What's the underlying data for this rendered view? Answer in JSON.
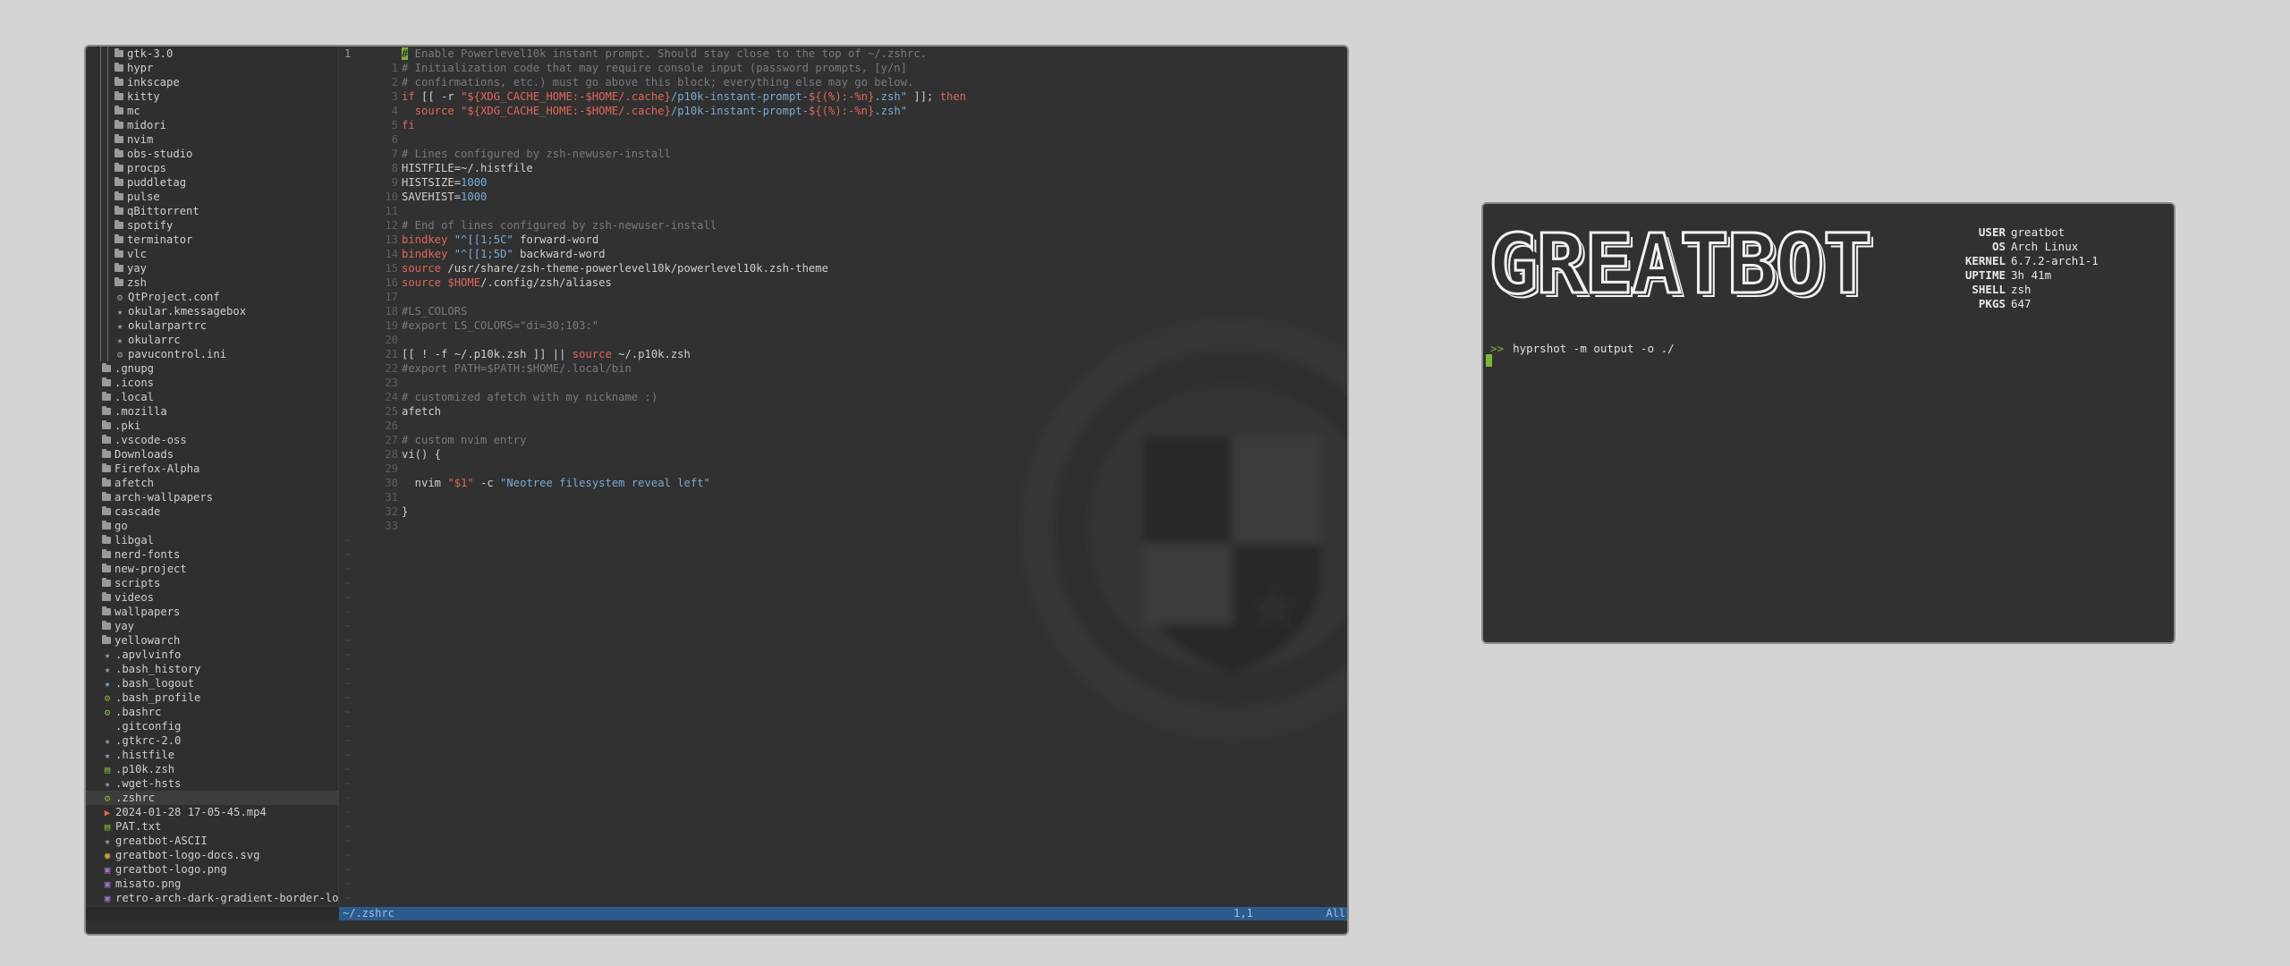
{
  "tree": {
    "nested": [
      {
        "label": "gtk-3.0",
        "type": "folder"
      },
      {
        "label": "hypr",
        "type": "folder"
      },
      {
        "label": "inkscape",
        "type": "folder"
      },
      {
        "label": "kitty",
        "type": "folder"
      },
      {
        "label": "mc",
        "type": "folder"
      },
      {
        "label": "midori",
        "type": "folder"
      },
      {
        "label": "nvim",
        "type": "folder"
      },
      {
        "label": "obs-studio",
        "type": "folder"
      },
      {
        "label": "procps",
        "type": "folder"
      },
      {
        "label": "puddletag",
        "type": "folder"
      },
      {
        "label": "pulse",
        "type": "folder"
      },
      {
        "label": "qBittorrent",
        "type": "folder"
      },
      {
        "label": "spotify",
        "type": "folder"
      },
      {
        "label": "terminator",
        "type": "folder"
      },
      {
        "label": "vlc",
        "type": "folder"
      },
      {
        "label": "yay",
        "type": "folder"
      },
      {
        "label": "zsh",
        "type": "folder"
      },
      {
        "label": "QtProject.conf",
        "type": "gear"
      },
      {
        "label": "okular.kmessagebox",
        "type": "star"
      },
      {
        "label": "okularpartrc",
        "type": "star"
      },
      {
        "label": "okularrc",
        "type": "star"
      },
      {
        "label": "pavucontrol.ini",
        "type": "gear"
      }
    ],
    "top": [
      {
        "label": ".gnupg",
        "type": "folder"
      },
      {
        "label": ".icons",
        "type": "folder"
      },
      {
        "label": ".local",
        "type": "folder"
      },
      {
        "label": ".mozilla",
        "type": "folder"
      },
      {
        "label": ".pki",
        "type": "folder"
      },
      {
        "label": ".vscode-oss",
        "type": "folder"
      },
      {
        "label": "Downloads",
        "type": "folder"
      },
      {
        "label": "Firefox-Alpha",
        "type": "folder"
      },
      {
        "label": "afetch",
        "type": "folder"
      },
      {
        "label": "arch-wallpapers",
        "type": "folder"
      },
      {
        "label": "cascade",
        "type": "folder"
      },
      {
        "label": "go",
        "type": "folder"
      },
      {
        "label": "libgal",
        "type": "folder"
      },
      {
        "label": "nerd-fonts",
        "type": "folder"
      },
      {
        "label": "new-project",
        "type": "folder"
      },
      {
        "label": "scripts",
        "type": "folder"
      },
      {
        "label": "videos",
        "type": "folder"
      },
      {
        "label": "wallpapers",
        "type": "folder"
      },
      {
        "label": "yay",
        "type": "folder"
      },
      {
        "label": "yellowarch",
        "type": "folder"
      },
      {
        "label": ".apvlvinfo",
        "type": "star"
      },
      {
        "label": ".bash_history",
        "type": "star"
      },
      {
        "label": ".bash_logout",
        "type": "star-blue"
      },
      {
        "label": ".bash_profile",
        "type": "gear-green"
      },
      {
        "label": ".bashrc",
        "type": "gear-green"
      },
      {
        "label": ".gitconfig",
        "type": "none"
      },
      {
        "label": ".gtkrc-2.0",
        "type": "star"
      },
      {
        "label": ".histfile",
        "type": "star"
      },
      {
        "label": ".p10k.zsh",
        "type": "file-green"
      },
      {
        "label": ".wget-hsts",
        "type": "star"
      },
      {
        "label": ".zshrc",
        "type": "gear-green",
        "selected": true
      },
      {
        "label": "2024-01-28 17-05-45.mp4",
        "type": "video"
      },
      {
        "label": "PAT.txt",
        "type": "file-green"
      },
      {
        "label": "greatbot-ASCII",
        "type": "star"
      },
      {
        "label": "greatbot-logo-docs.svg",
        "type": "svg"
      },
      {
        "label": "greatbot-logo.png",
        "type": "image"
      },
      {
        "label": "misato.png",
        "type": "image"
      },
      {
        "label": "retro-arch-dark-gradient-border-lo",
        "type": "image"
      }
    ]
  },
  "editor": {
    "current_line": "1",
    "relative_numbers": [
      "1",
      "2",
      "3",
      "4",
      "5",
      "6",
      "7",
      "8",
      "9",
      "10",
      "11",
      "12",
      "13",
      "14",
      "15",
      "16",
      "17",
      "18",
      "19",
      "20",
      "21",
      "22",
      "23",
      "24",
      "25",
      "26",
      "27",
      "28",
      "29",
      "30",
      "31",
      "32",
      "33"
    ],
    "lines": [
      [
        [
          "cursor-cell",
          "#"
        ],
        [
          "cmt",
          " Enable Powerlevel10k instant prompt. Should stay close to the top of ~/.zshrc."
        ]
      ],
      [
        [
          "cmt",
          "# Initialization code that may require console input (password prompts, [y/n]"
        ]
      ],
      [
        [
          "cmt",
          "# confirmations, etc.) must go above this block; everything else may go below."
        ]
      ],
      [
        [
          "kw",
          "if"
        ],
        [
          "",
          " [[ -r "
        ],
        [
          "str",
          "\"${XDG_CACHE_HOME:-$HOME/.cache}"
        ],
        [
          "blu",
          "/p10k-instant-prompt-"
        ],
        [
          "str",
          "${(%):-%n}"
        ],
        [
          "blu",
          ".zsh\""
        ],
        [
          "",
          " ]]; "
        ],
        [
          "kw",
          "then"
        ]
      ],
      [
        [
          "",
          "  "
        ],
        [
          "kw",
          "source"
        ],
        [
          "",
          " "
        ],
        [
          "str",
          "\"${XDG_CACHE_HOME:-$HOME/.cache}"
        ],
        [
          "blu",
          "/p10k-instant-prompt-"
        ],
        [
          "str",
          "${(%):-%n}"
        ],
        [
          "blu",
          ".zsh\""
        ]
      ],
      [
        [
          "kw",
          "fi"
        ]
      ],
      [
        [
          "",
          ""
        ]
      ],
      [
        [
          "cmt",
          "# Lines configured by zsh-newuser-install"
        ]
      ],
      [
        [
          "",
          "HISTFILE=~/.histfile"
        ]
      ],
      [
        [
          "",
          "HISTSIZE="
        ],
        [
          "num",
          "1000"
        ]
      ],
      [
        [
          "",
          "SAVEHIST="
        ],
        [
          "num",
          "1000"
        ]
      ],
      [
        [
          "",
          ""
        ]
      ],
      [
        [
          "cmt",
          "# End of lines configured by zsh-newuser-install"
        ]
      ],
      [
        [
          "kw",
          "bindkey"
        ],
        [
          "",
          " "
        ],
        [
          "blu",
          "\"^[[1;5C\""
        ],
        [
          "",
          " forward-word"
        ]
      ],
      [
        [
          "kw",
          "bindkey"
        ],
        [
          "",
          " "
        ],
        [
          "blu",
          "\"^[[1;5D\""
        ],
        [
          "",
          " backward-word"
        ]
      ],
      [
        [
          "kw",
          "source"
        ],
        [
          "",
          " /usr/share/zsh-theme-powerlevel10k/powerlevel10k.zsh-theme"
        ]
      ],
      [
        [
          "kw",
          "source"
        ],
        [
          "",
          " "
        ],
        [
          "var",
          "$HOME"
        ],
        [
          "",
          "/.config/zsh/aliases"
        ]
      ],
      [
        [
          "",
          ""
        ]
      ],
      [
        [
          "cmt",
          "#LS_COLORS"
        ]
      ],
      [
        [
          "cmt",
          "#export LS_COLORS=\"di=30;103:\""
        ]
      ],
      [
        [
          "",
          ""
        ]
      ],
      [
        [
          "",
          "[[ ! -f ~/.p10k.zsh ]] || "
        ],
        [
          "kw",
          "source"
        ],
        [
          "",
          " ~/.p10k.zsh"
        ]
      ],
      [
        [
          "cmt",
          "#export PATH=$PATH:$HOME/.local/bin"
        ]
      ],
      [
        [
          "",
          ""
        ]
      ],
      [
        [
          "cmt",
          "# customized afetch with my nickname :)"
        ]
      ],
      [
        [
          "",
          "afetch"
        ]
      ],
      [
        [
          "",
          ""
        ]
      ],
      [
        [
          "cmt",
          "# custom nvim entry"
        ]
      ],
      [
        [
          "",
          "vi() {"
        ]
      ],
      [
        [
          "",
          ""
        ]
      ],
      [
        [
          "",
          "  nvim "
        ],
        [
          "str",
          "\"$1\""
        ],
        [
          "",
          " -c "
        ],
        [
          "blu",
          "\"Neotree filesystem reveal left\""
        ]
      ],
      [
        [
          "",
          ""
        ]
      ],
      [
        [
          "",
          "}"
        ]
      ],
      [
        [
          "",
          ""
        ]
      ]
    ],
    "tilde_rows": 26
  },
  "statusline": {
    "file": "~/.zshrc",
    "position": "1,1",
    "percent": "All"
  },
  "terminal": {
    "logo": "GREATBOT",
    "info": [
      {
        "key": "USER",
        "value": "greatbot"
      },
      {
        "key": "OS",
        "value": "Arch Linux"
      },
      {
        "key": "KERNEL",
        "value": "6.7.2-arch1-1"
      },
      {
        "key": "UPTIME",
        "value": "3h 41m"
      },
      {
        "key": "SHELL",
        "value": "zsh"
      },
      {
        "key": "PKGS",
        "value": "647"
      }
    ],
    "prompt_symbol": ">>",
    "command": "hyprshot -m output -o ./"
  },
  "colors": {
    "desktop_bg": "#d4d4d4",
    "window_bg": "#313131",
    "accent_green": "#7fb43a",
    "statusline_blue": "#2d5a8c",
    "keyword_red": "#e0665c",
    "string_blue": "#7aaad6"
  }
}
